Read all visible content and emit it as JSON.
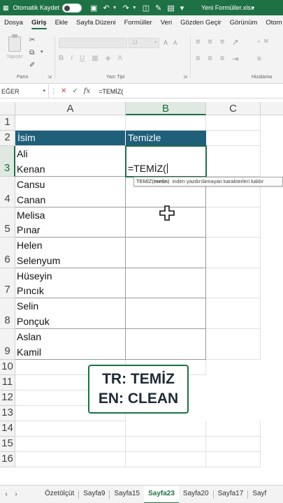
{
  "titlebar": {
    "autosave_label": "Otomatik Kaydet",
    "document_title": "Yeni Formüller.xlsx",
    "colors": {
      "brand": "#1e7145"
    }
  },
  "ribbon": {
    "tabs": [
      "Dosya",
      "Giriş",
      "Ekle",
      "Sayfa Düzeni",
      "Formüller",
      "Veri",
      "Gözden Geçir",
      "Görünüm",
      "Otom"
    ],
    "active_tab": "Giriş",
    "paste_label": "Yapıştır",
    "groups": {
      "clipboard": "Pano",
      "font": "Yazı Tipi",
      "alignment": "Hizalama"
    },
    "font_size": "11",
    "wrap_hint": "M"
  },
  "formula_bar": {
    "name_box": "EĞER",
    "fx_label": "fx",
    "formula": "=TEMİZ("
  },
  "grid": {
    "columns": [
      "A",
      "B",
      "C"
    ],
    "selected_column": "B",
    "rows": [
      "1",
      "2",
      "3",
      "4",
      "5",
      "6",
      "7",
      "8",
      "9",
      "10",
      "11",
      "12",
      "13",
      "14",
      "15",
      "16"
    ],
    "selected_row": "3",
    "table_header": {
      "col_a": "İsim",
      "col_b": "Temizle",
      "color": "#1f5f7a"
    },
    "data_rows": [
      {
        "row": "3",
        "lines": [
          "Ali",
          "Kenan"
        ]
      },
      {
        "row": "4",
        "lines": [
          "Cansu",
          "Canan"
        ]
      },
      {
        "row": "5",
        "lines": [
          "Melisa",
          "Pınar"
        ]
      },
      {
        "row": "6",
        "lines": [
          "Helen",
          "Selenyum"
        ]
      },
      {
        "row": "7",
        "lines": [
          "Hüseyin",
          "Pıncık"
        ]
      },
      {
        "row": "8",
        "lines": [
          "Selin",
          "Ponçuk"
        ]
      },
      {
        "row": "9",
        "lines": [
          "Aslan",
          "Kamil"
        ]
      }
    ],
    "active_cell_text": "=TEMİZ("
  },
  "tooltip": {
    "fn_name": "TEMİZ(",
    "arg": "metin",
    "close": ")",
    "description": "inden yazdırılamayan karakterleri kaldır"
  },
  "callout": {
    "line1": "TR: TEMİZ",
    "line2": "EN: CLEAN"
  },
  "sheet_tabs": {
    "tabs": [
      "Özetölçüt",
      "Sayfa9",
      "Sayfa15",
      "Sayfa23",
      "Sayfa20",
      "Sayfa17",
      "Sayf"
    ],
    "active": "Sayfa23"
  }
}
